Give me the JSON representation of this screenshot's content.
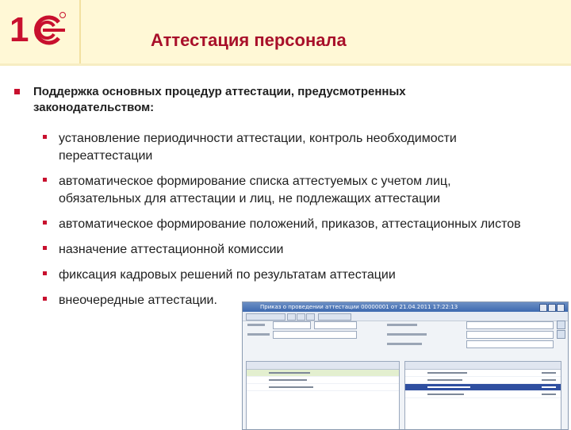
{
  "slide": {
    "title": "Аттестация персонала",
    "logo_text": "1С",
    "main_point": "Поддержка основных процедур аттестации, предусмотренных законодательством:",
    "items": [
      "установление периодичности аттестации, контроль необходимости переаттестации",
      "автоматическое формирование списка аттестуемых с учетом лиц, обязательных   для аттестации и лиц, не подлежащих аттестации",
      "автоматическое формирование положений, приказов, аттестационных листов",
      "назначение аттестационной комиссии",
      "фиксация кадровых решений по результатам аттестации",
      "внеочередные аттестации."
    ]
  },
  "colors": {
    "title": "#a8102a",
    "bullet": "#c8102e",
    "header_bg": "#fff8d6",
    "window_titlebar": "#3d69b0",
    "selected_row": "#2f4fa0"
  },
  "screenshot": {
    "window_title": "Приказ о проведении аттестации 00000001 от 21.04.2011 17:22:13",
    "icons": [
      "window-minimize-icon",
      "window-maximize-icon",
      "window-close-icon"
    ]
  }
}
